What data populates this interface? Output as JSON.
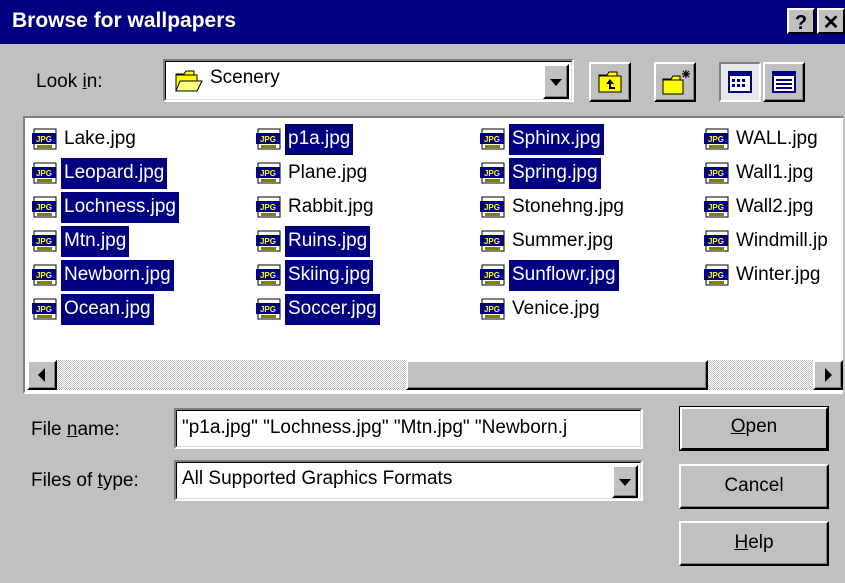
{
  "window": {
    "title": "Browse for wallpapers",
    "help_glyph": "?",
    "close_glyph": "✕"
  },
  "lookin": {
    "label_pre": "Look ",
    "label_key": "i",
    "label_post": "n:",
    "value": "Scenery"
  },
  "files": {
    "columns": [
      [
        {
          "name": "Lake.jpg",
          "selected": false
        },
        {
          "name": "Leopard.jpg",
          "selected": true
        },
        {
          "name": "Lochness.jpg",
          "selected": true
        },
        {
          "name": "Mtn.jpg",
          "selected": true
        },
        {
          "name": "Newborn.jpg",
          "selected": true
        },
        {
          "name": "Ocean.jpg",
          "selected": true
        }
      ],
      [
        {
          "name": "p1a.jpg",
          "selected": true,
          "focused": true
        },
        {
          "name": "Plane.jpg",
          "selected": false
        },
        {
          "name": "Rabbit.jpg",
          "selected": false
        },
        {
          "name": "Ruins.jpg",
          "selected": true
        },
        {
          "name": "Skiing.jpg",
          "selected": true
        },
        {
          "name": "Soccer.jpg",
          "selected": true
        }
      ],
      [
        {
          "name": "Sphinx.jpg",
          "selected": true
        },
        {
          "name": "Spring.jpg",
          "selected": true
        },
        {
          "name": "Stonehng.jpg",
          "selected": false
        },
        {
          "name": "Summer.jpg",
          "selected": false
        },
        {
          "name": "Sunflowr.jpg",
          "selected": true
        },
        {
          "name": "Venice.jpg",
          "selected": false
        }
      ],
      [
        {
          "name": "WALL.jpg",
          "selected": false
        },
        {
          "name": "Wall1.jpg",
          "selected": false
        },
        {
          "name": "Wall2.jpg",
          "selected": false
        },
        {
          "name": "Windmill.jp",
          "selected": false
        },
        {
          "name": "Winter.jpg",
          "selected": false
        }
      ]
    ],
    "icon_label": "JPG"
  },
  "filename": {
    "label_pre": "File ",
    "label_key": "n",
    "label_post": "ame:",
    "value": "\"p1a.jpg\" \"Lochness.jpg\" \"Mtn.jpg\" \"Newborn.j"
  },
  "filetype": {
    "label_pre": "Files of ",
    "label_key": "t",
    "label_post": "ype:",
    "value": "All Supported Graphics Formats"
  },
  "buttons": {
    "open": {
      "key": "O",
      "rest": "pen"
    },
    "cancel": {
      "label": "Cancel"
    },
    "help": {
      "key": "H",
      "rest": "elp"
    }
  },
  "colors": {
    "title_bg": "#000080",
    "face": "#c0c0c0",
    "selection": "#000080",
    "folder": "#ffff00"
  }
}
